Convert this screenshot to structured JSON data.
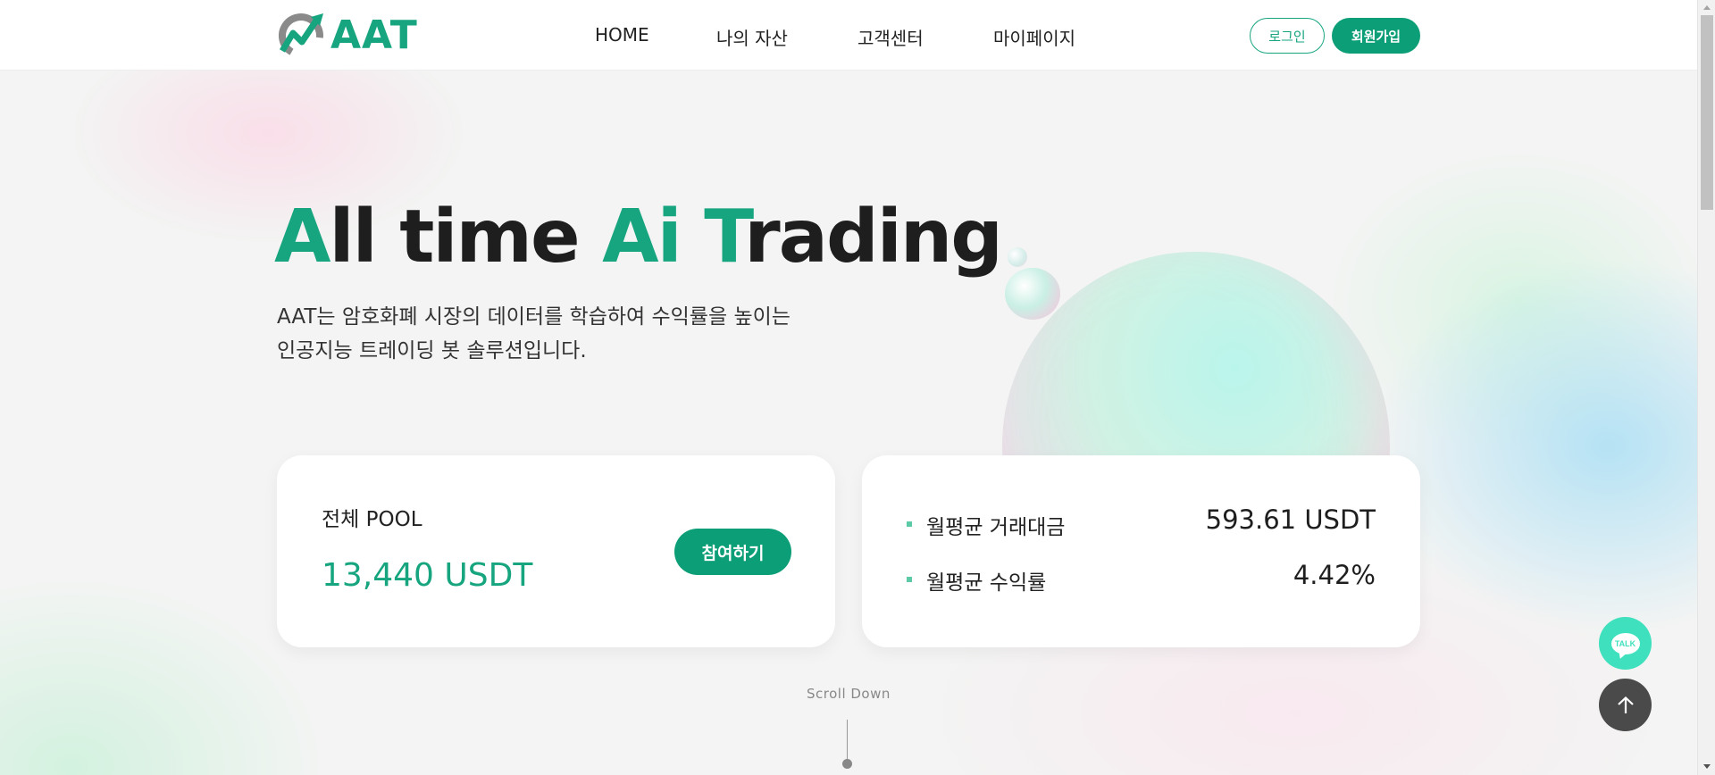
{
  "header": {
    "logo_text": "AAT",
    "nav": [
      "HOME",
      "나의 자산",
      "고객센터",
      "마이페이지"
    ],
    "login_label": "로그인",
    "signup_label": "회원가입"
  },
  "hero": {
    "title_parts": [
      "A",
      "ll time ",
      "Ai",
      " ",
      "T",
      "rading"
    ],
    "subtitle_line1": "AAT는 암호화폐 시장의 데이터를 학습하여 수익률을 높이는",
    "subtitle_line2": "인공지능 트레이딩 봇 솔루션입니다."
  },
  "pool_card": {
    "label": "전체 POOL",
    "value": "13,440 USDT",
    "join_label": "참여하기"
  },
  "stats_card": {
    "rows": [
      {
        "label": "월평균 거래대금",
        "value": "593.61 USDT"
      },
      {
        "label": "월평균 수익률",
        "value": "4.42%"
      }
    ]
  },
  "scroll_hint": "Scroll Down",
  "talk_label": "TALK",
  "colors": {
    "brand": "#16a57f",
    "button": "#0c9e76",
    "talk": "#3fe0bd",
    "top_button": "#4a4a4a"
  },
  "icons": {
    "logo": "chart-arrow-logo-icon",
    "talk": "chat-bubble-icon",
    "scroll_top": "arrow-up-icon"
  }
}
